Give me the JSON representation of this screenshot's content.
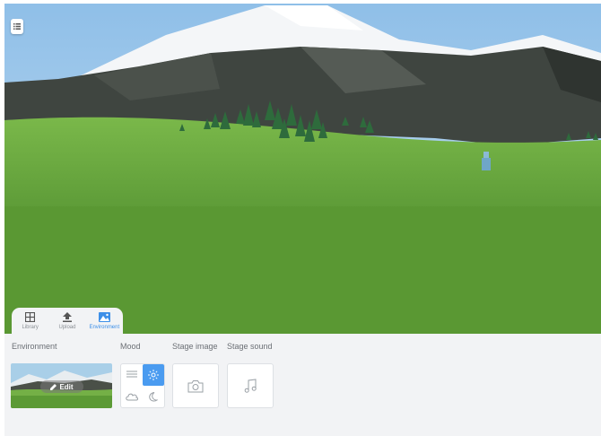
{
  "tabs": [
    {
      "label": "Library",
      "icon": "grid-icon"
    },
    {
      "label": "Upload",
      "icon": "upload-icon"
    },
    {
      "label": "Environment",
      "icon": "landscape-icon",
      "active": true
    }
  ],
  "sections": {
    "environment": "Environment",
    "mood": "Mood",
    "stage_image": "Stage image",
    "stage_sound": "Stage sound"
  },
  "edit_button": {
    "label": "Edit",
    "icon": "pencil-icon"
  },
  "mood_options": [
    {
      "icon": "fog-icon",
      "active": false
    },
    {
      "icon": "sun-icon",
      "active": true
    },
    {
      "icon": "cloud-icon",
      "active": false
    },
    {
      "icon": "moon-icon",
      "active": false
    }
  ],
  "colors": {
    "accent": "#3d8fe8",
    "sky": "#9ec7ea",
    "grass": "#5c9a35",
    "mountain": "#3f4540"
  }
}
